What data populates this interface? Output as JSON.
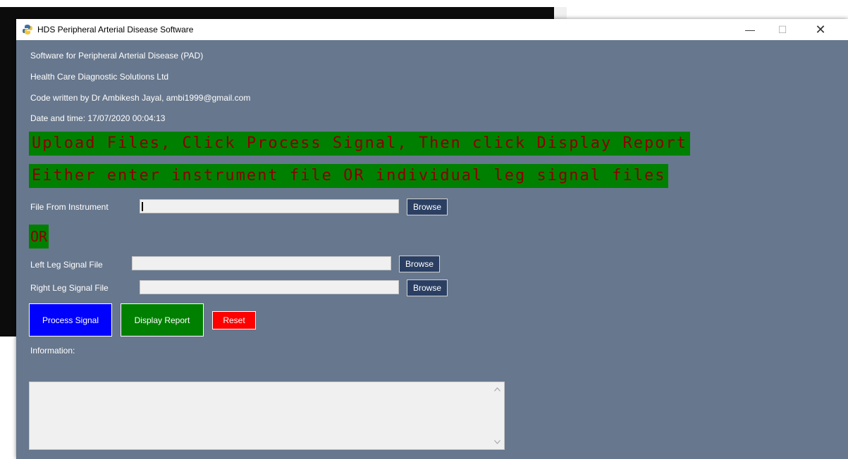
{
  "window": {
    "title": "HDS Peripheral Arterial Disease Software",
    "minimize_glyph": "—",
    "maximize_glyph": "☐",
    "close_glyph": "✕"
  },
  "info": {
    "line1": "Software for Peripheral Arterial Disease (PAD)",
    "line2": "Health Care Diagnostic Solutions Ltd",
    "line3": "Code written by Dr Ambikesh Jayal, ambi1999@gmail.com",
    "line4": "Date and time: 17/07/2020 00:04:13"
  },
  "banners": {
    "instructions": "Upload Files, Click Process Signal, Then click Display Report",
    "either": "Either enter instrument file OR individual leg signal files",
    "or": "OR"
  },
  "fields": {
    "instrument_label": "File From Instrument",
    "instrument_value": "",
    "left_label": "Left Leg Signal File",
    "left_value": "",
    "right_label": "Right Leg Signal File",
    "right_value": "",
    "browse_label": "Browse"
  },
  "actions": {
    "process": "Process Signal",
    "display": "Display Report",
    "reset": "Reset"
  },
  "information": {
    "label": "Information:",
    "text": ""
  },
  "colors": {
    "window_bg": "#67778d",
    "banner_bg": "#008000",
    "banner_text": "#8b0000",
    "browse_bg": "#2b3f63",
    "process_bg": "#0000ff",
    "display_bg": "#008000",
    "reset_bg": "#ff0000"
  },
  "icons": {
    "app": "python-logo-icon",
    "scroll_up": "chevron-up-icon",
    "scroll_down": "chevron-down-icon"
  }
}
